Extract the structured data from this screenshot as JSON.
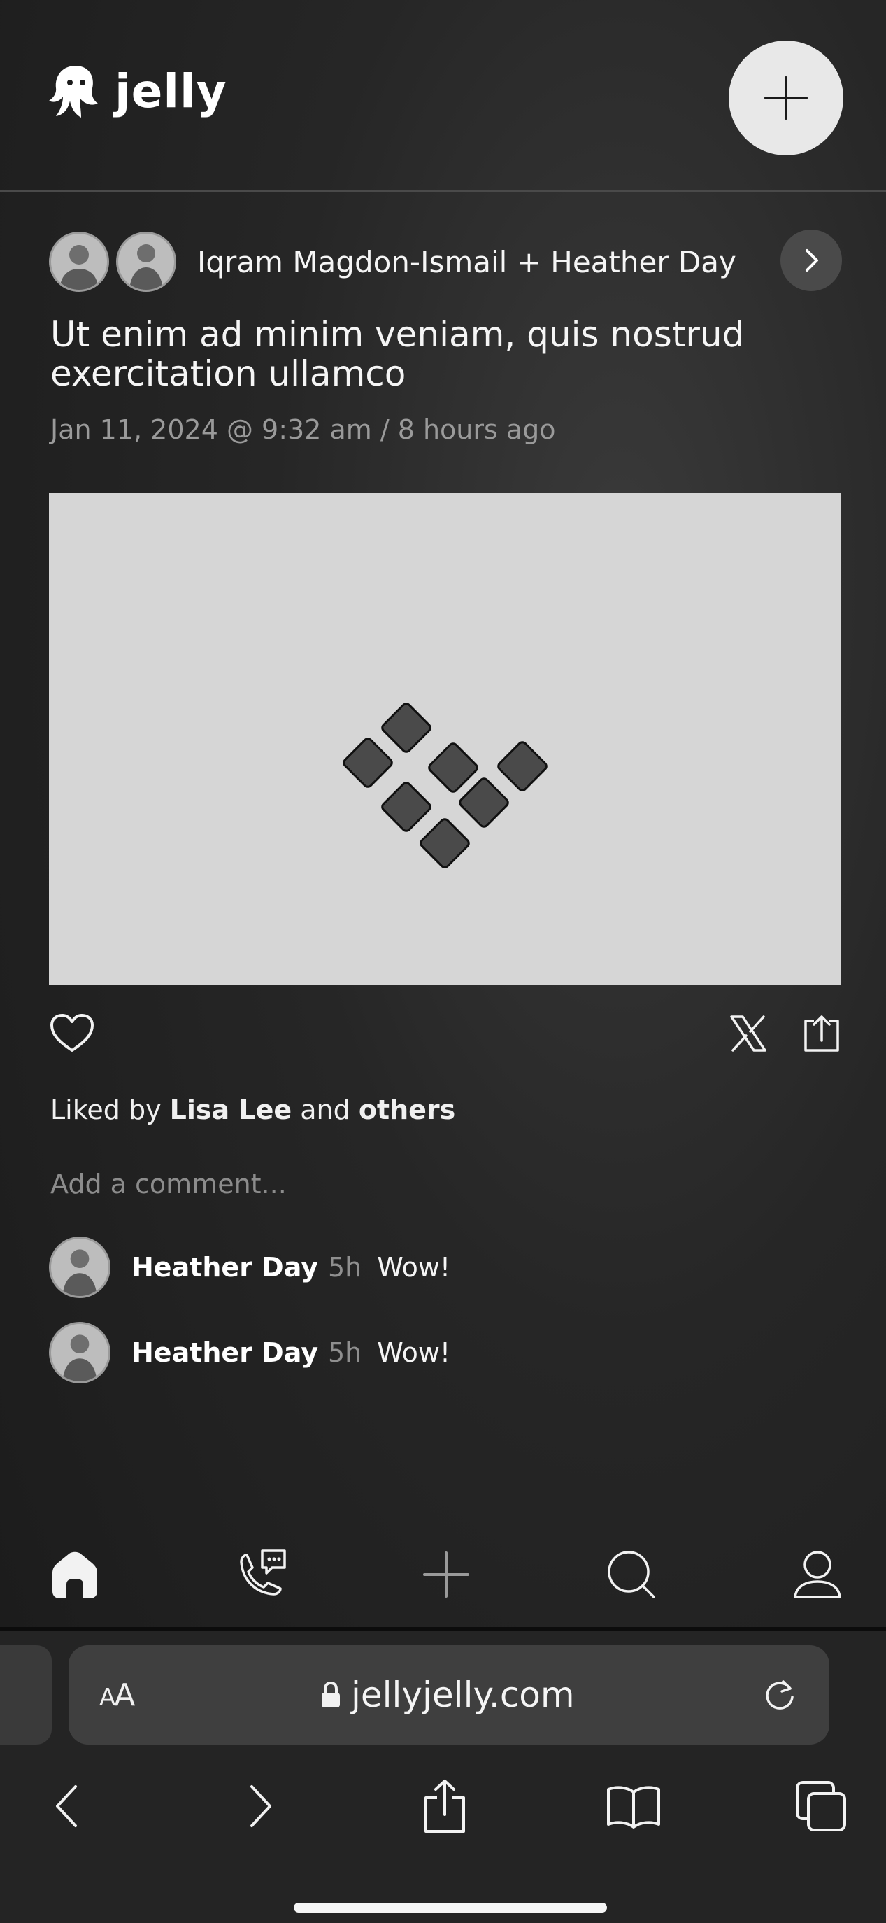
{
  "header": {
    "logo_text": "jelly",
    "new_post_icon": "plus-icon"
  },
  "post": {
    "authors": "Iqram Magdon-Ismail + Heather Day",
    "text": "Ut enim ad minim veniam, quis nostrud exercitation ullamco",
    "meta": "Jan 11, 2024 @ 9:32 am / 8 hours ago",
    "likes": {
      "prefix": "Liked by ",
      "name": "Lisa Lee",
      "middle": " and ",
      "others": "others"
    },
    "comment_placeholder": "Add a comment...",
    "comments": [
      {
        "author": "Heather Day",
        "time": "5h",
        "text": "Wow!"
      },
      {
        "author": "Heather Day",
        "time": "5h",
        "text": "Wow!"
      }
    ]
  },
  "tabs": [
    "home-icon",
    "phone-chat-icon",
    "plus-icon",
    "search-icon",
    "profile-icon"
  ],
  "browser": {
    "aa_large": "A",
    "aa_small": "A",
    "url": "jellyjelly.com"
  }
}
